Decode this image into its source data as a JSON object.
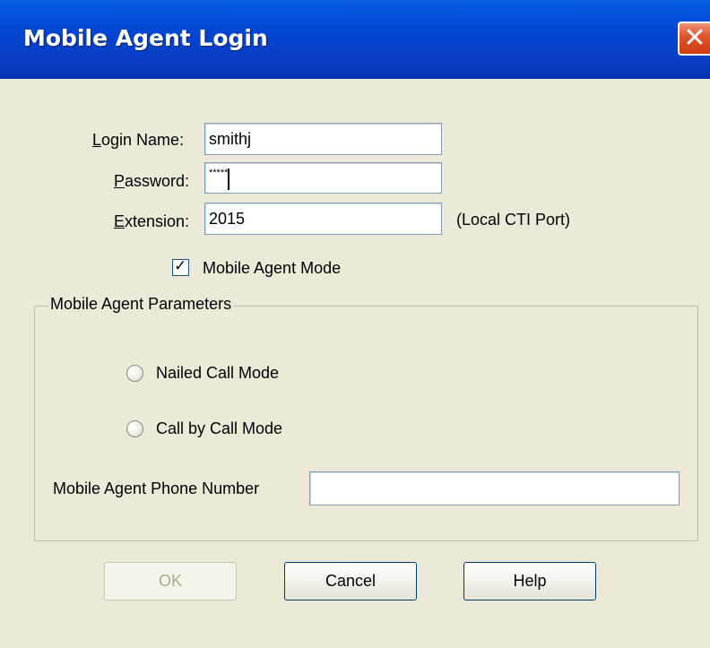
{
  "window": {
    "title": "Mobile Agent Login"
  },
  "fields": {
    "login_name": {
      "label": "Login Name:",
      "accel": "L",
      "rest": "ogin Name:",
      "value": "smithj"
    },
    "password": {
      "label": "Password:",
      "accel": "P",
      "rest": "assword:",
      "value": "*****"
    },
    "extension": {
      "label": "Extension:",
      "accel": "E",
      "rest": "xtension:",
      "value": "2015",
      "note": "(Local CTI Port)"
    }
  },
  "mobile_agent_mode": {
    "label": "Mobile Agent Mode",
    "checked": true
  },
  "parameters": {
    "group_label": "Mobile Agent Parameters",
    "radio_nailed": {
      "label": "Nailed Call Mode",
      "selected": false
    },
    "radio_call_by_call": {
      "label": "Call by Call Mode",
      "selected": false
    },
    "phone_number": {
      "label": "Mobile Agent Phone Number",
      "value": ""
    }
  },
  "buttons": {
    "ok": "OK",
    "cancel": "Cancel",
    "help": "Help"
  },
  "colors": {
    "titlebar": "#0246d2",
    "dialog_bg": "#ece9d8",
    "close_button": "#e0552c"
  },
  "icons": {
    "close": "close-icon",
    "check": "checkmark-icon"
  }
}
